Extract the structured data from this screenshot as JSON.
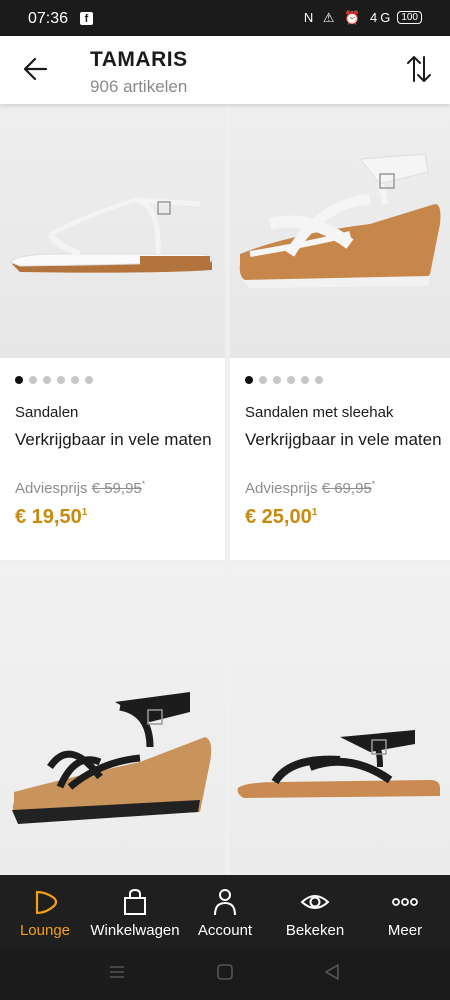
{
  "status_bar": {
    "time": "07:36",
    "app_icon": "facebook-icon",
    "indicators": "N ⚠ ⏰ 4G",
    "battery": "100"
  },
  "header": {
    "title": "TAMARIS",
    "count": "906 artikelen",
    "back_icon": "arrow-left-icon",
    "sort_icon": "sort-arrows-icon"
  },
  "products": [
    {
      "category": "Sandalen",
      "name": "Verkrijgbaar in vele maten",
      "advice_label": "Adviesprijs",
      "old_price": "€ 59,95",
      "advice_mark": "*",
      "price": "€ 19,50",
      "price_mark": "1",
      "image_count": 6,
      "active_image": 0
    },
    {
      "category": "Sandalen met sleehak",
      "name": "Verkrijgbaar in vele maten",
      "advice_label": "Adviesprijs",
      "old_price": "€ 69,95",
      "advice_mark": "*",
      "price": "€ 25,00",
      "price_mark": "1",
      "image_count": 6,
      "active_image": 0
    }
  ],
  "bottom_nav": [
    {
      "label": "Lounge",
      "icon": "lounge-icon",
      "active": true
    },
    {
      "label": "Winkelwagen",
      "icon": "shopping-bag-icon",
      "active": false
    },
    {
      "label": "Account",
      "icon": "person-icon",
      "active": false
    },
    {
      "label": "Bekeken",
      "icon": "eye-icon",
      "active": false
    },
    {
      "label": "Meer",
      "icon": "more-dots-icon",
      "active": false
    }
  ],
  "colors": {
    "accent": "#c98a0e",
    "nav_active": "#f2a016",
    "nav_background": "#1f1f1f"
  }
}
